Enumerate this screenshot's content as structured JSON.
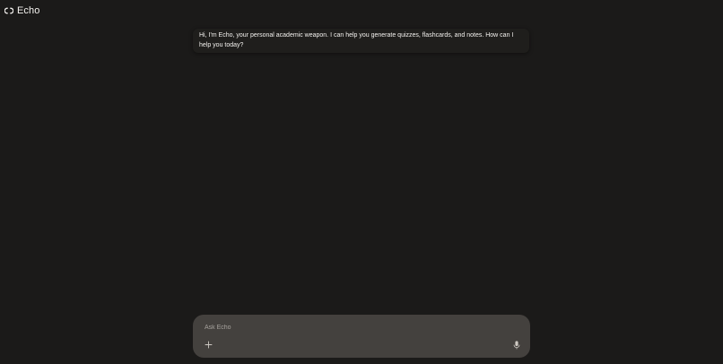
{
  "header": {
    "app_name": "Echo",
    "logo_icon": "echo-logo-icon"
  },
  "chat": {
    "messages": [
      {
        "role": "assistant",
        "text": "Hi, I'm Echo, your personal academic weapon. I can help you generate quizzes, flashcards, and notes. How can I help you today?"
      }
    ]
  },
  "composer": {
    "placeholder": "Ask Echo",
    "value": "",
    "add_icon": "plus-icon",
    "mic_icon": "microphone-icon"
  },
  "colors": {
    "background": "#1b1a19",
    "message_bubble": "#1f1e1c",
    "composer_bg": "#44413e",
    "text": "#f4f2ef",
    "placeholder": "#a6a29d"
  }
}
